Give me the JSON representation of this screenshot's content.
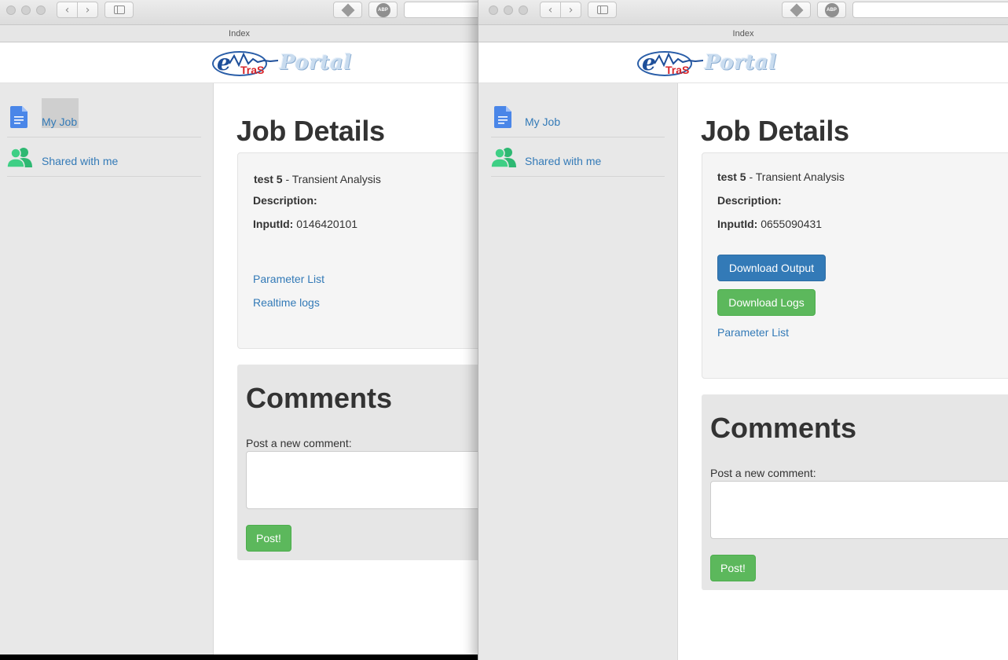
{
  "windows": [
    {
      "tab_title": "Index",
      "logo": {
        "e": "e",
        "tras": "TraS",
        "portal": "Portal"
      },
      "sidebar": {
        "items": [
          {
            "label": "My Job",
            "icon": "document-icon"
          },
          {
            "label": "Shared with me",
            "icon": "users-icon"
          }
        ]
      },
      "main": {
        "title": "Job Details",
        "job_name": "test 5",
        "job_type": " - Transient Analysis",
        "description_label": "Description:",
        "input_label": "InputId:",
        "input_value": " 0146420101",
        "links": [
          "Parameter List",
          "Realtime logs"
        ]
      },
      "comments": {
        "title": "Comments",
        "label": "Post a new comment:",
        "textarea_value": "",
        "post_label": "Post!"
      }
    },
    {
      "tab_title": "Index",
      "logo": {
        "e": "e",
        "tras": "TraS",
        "portal": "Portal"
      },
      "sidebar": {
        "items": [
          {
            "label": "My Job",
            "icon": "document-icon"
          },
          {
            "label": "Shared with me",
            "icon": "users-icon"
          }
        ]
      },
      "main": {
        "title": "Job Details",
        "job_name": "test 5",
        "job_type": " - Transient Analysis",
        "description_label": "Description:",
        "input_label": "InputId:",
        "input_value": " 0655090431",
        "buttons": [
          "Download Output",
          "Download Logs"
        ],
        "links": [
          "Parameter List"
        ]
      },
      "comments": {
        "title": "Comments",
        "label": "Post a new comment:",
        "textarea_value": "",
        "post_label": "Post!"
      }
    }
  ],
  "toolbar": {
    "abp_label": "ABP"
  },
  "colors": {
    "link": "#337ab7",
    "primary": "#337ab7",
    "success": "#5cb85c",
    "sidebar_bg": "#e8e8e8",
    "well_bg": "#f5f5f5",
    "comments_bg": "#e6e6e6",
    "doc_icon": "#4a86e8",
    "users_icon": "#2eb872",
    "logo_red": "#d8262a",
    "logo_blue": "#1e4f9a"
  }
}
